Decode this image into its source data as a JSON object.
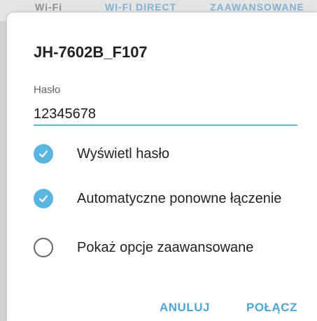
{
  "background": {
    "tabs": [
      "Wi-Fi",
      "WI-FI DIRECT",
      "ZAAWANSOWANE"
    ]
  },
  "dialog": {
    "title": "JH-7602B_F107",
    "password_label": "Hasło",
    "password_value": "12345678",
    "options": [
      {
        "label": "Wyświetl hasło",
        "checked": true
      },
      {
        "label": "Automatyczne ponowne łączenie",
        "checked": true
      },
      {
        "label": "Pokaż opcje zaawansowane",
        "checked": false
      }
    ],
    "buttons": {
      "cancel": "ANULUJ",
      "connect": "POŁĄCZ"
    }
  },
  "colors": {
    "accent": "#5ab6e0",
    "button_text": "#4fa6d4"
  }
}
